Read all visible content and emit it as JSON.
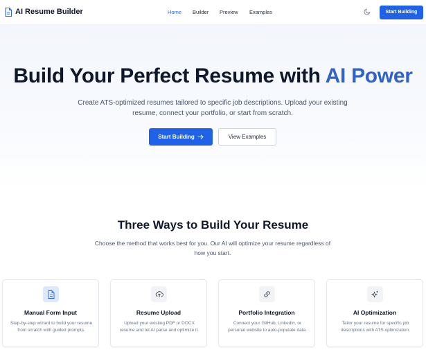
{
  "header": {
    "brand": "AI Resume Builder",
    "nav": [
      "Home",
      "Builder",
      "Preview",
      "Examples"
    ],
    "cta": "Start Building"
  },
  "hero": {
    "title_main": "Build Your Perfect Resume with ",
    "title_accent": "AI Power",
    "subtitle": "Create ATS-optimized resumes tailored to specific job descriptions. Upload your existing resume, connect your portfolio, or start from scratch.",
    "primary_button": "Start Building",
    "secondary_button": "View Examples"
  },
  "features": {
    "title": "Three Ways to Build Your Resume",
    "subtitle": "Choose the method that works best for you. Our AI will optimize your resume regardless of how you start.",
    "cards": [
      {
        "icon": "document-icon",
        "title": "Manual Form Input",
        "desc": "Step-by-step wizard to build your resume from scratch with guided prompts."
      },
      {
        "icon": "upload-icon",
        "title": "Resume Upload",
        "desc": "Upload your existing PDF or DOCX resume and let AI parse and optimize it."
      },
      {
        "icon": "link-icon",
        "title": "Portfolio Integration",
        "desc": "Connect your GitHub, LinkedIn, or personal website to auto-populate data."
      },
      {
        "icon": "sparkles-icon",
        "title": "AI Optimization",
        "desc": "Tailor your resume for specific job descriptions with ATS optimization."
      }
    ]
  },
  "colors": {
    "accent": "#1f62e8",
    "title_accent": "#2f63c8"
  }
}
